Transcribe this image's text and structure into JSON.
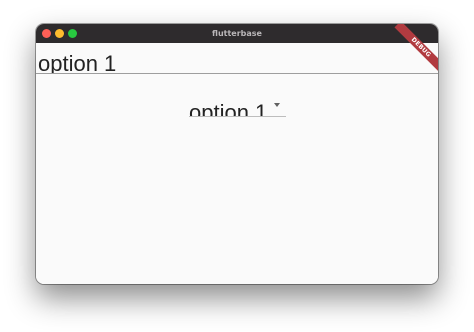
{
  "window": {
    "title": "flutterbase"
  },
  "top_select": {
    "value": "option 1"
  },
  "center_dropdown": {
    "value": "option 1"
  },
  "debug_banner": {
    "label": "DEBUG"
  },
  "icons": {
    "dropdown": "arrow-drop-down-icon"
  },
  "colors": {
    "titlebar": "#2e2b2d",
    "close": "#fe5f57",
    "minimize": "#febc2e",
    "zoom": "#28c840",
    "debug_banner": "#b13b40",
    "background": "#fafafa"
  }
}
